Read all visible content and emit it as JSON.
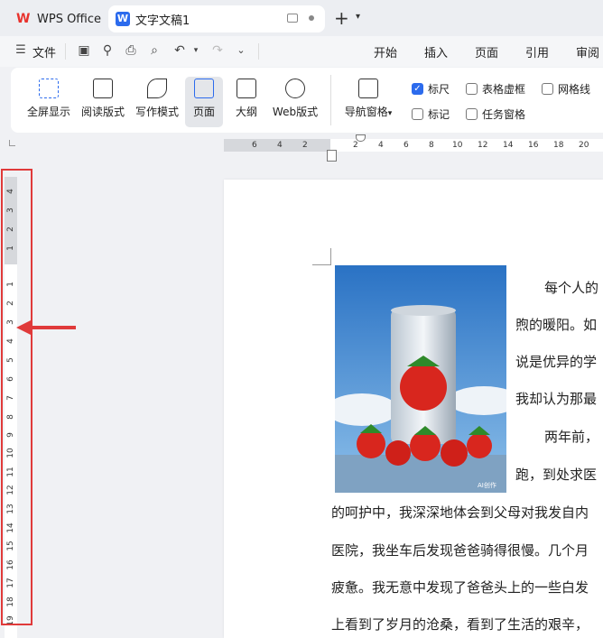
{
  "tabs": {
    "wps_office": "WPS Office",
    "document": "文字文稿1"
  },
  "menu": {
    "file": "文件",
    "items": [
      "开始",
      "插入",
      "页面",
      "引用",
      "审阅"
    ]
  },
  "ribbon": {
    "buttons": [
      "全屏显示",
      "阅读版式",
      "写作模式",
      "页面",
      "大纲",
      "Web版式",
      "导航窗格"
    ],
    "checkboxes": [
      {
        "label": "标尺",
        "checked": true
      },
      {
        "label": "表格虚框",
        "checked": false
      },
      {
        "label": "网格线",
        "checked": false
      },
      {
        "label": "标记",
        "checked": false
      },
      {
        "label": "任务窗格",
        "checked": false
      }
    ]
  },
  "hruler": {
    "left_ticks": [
      "6",
      "4",
      "2"
    ],
    "right_ticks": [
      "2",
      "4",
      "6",
      "8",
      "10",
      "12",
      "14",
      "16",
      "18",
      "20"
    ]
  },
  "vruler": {
    "top_ticks": [
      "4",
      "3",
      "2",
      "1"
    ],
    "ticks": [
      "1",
      "2",
      "3",
      "4",
      "5",
      "6",
      "7",
      "8",
      "9",
      "10",
      "11",
      "12",
      "13",
      "14",
      "15",
      "16",
      "17",
      "18",
      "19"
    ]
  },
  "document": {
    "image_caption": "AI创作",
    "lines": [
      "每个人的",
      "煦的暖阳。如",
      "说是优异的学",
      "我却认为那最",
      "两年前，",
      "跑，到处求医",
      "的呵护中，我深深地体会到父母对我发自内",
      "医院，我坐车后发现爸爸骑得很慢。几个月",
      "疲惫。我无意中发现了爸爸头上的一些白发",
      "上看到了岁月的沧桑，看到了生活的艰辛，"
    ]
  },
  "colors": {
    "accent": "#2c6bed",
    "highlight": "#e03a3a",
    "wps_red": "#e8322d"
  }
}
